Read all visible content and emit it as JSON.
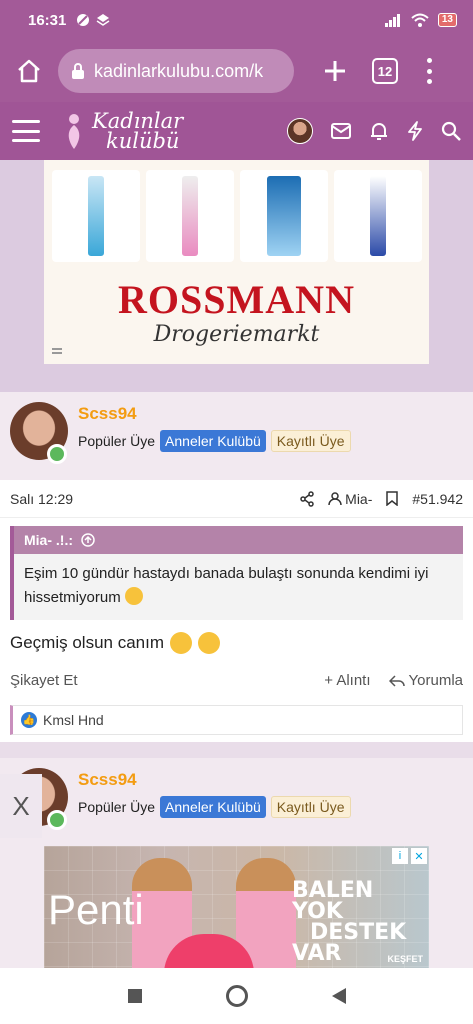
{
  "status_bar": {
    "time": "16:31",
    "battery": "13"
  },
  "browser": {
    "url": "kadinlarkulubu.com/k",
    "tab_count": "12"
  },
  "site": {
    "logo_line1": "Kadınlar",
    "logo_line2": "kulübü"
  },
  "ad_top": {
    "brand": "ROSSMANN",
    "subtitle": "Drogeriemarkt"
  },
  "post1": {
    "username": "Scss94",
    "rank": "Popüler Üye",
    "badge1": "Anneler Kulübü",
    "badge2": "Kayıtlı Üye",
    "date": "Salı 12:29",
    "quoted_user": "Mia-",
    "post_number": "#51.942",
    "quote_author": "Mia- .!.:",
    "quote_text": "Eşim 10 gündür hastaydı banada bulaştı sonunda kendimi iyi hissetmiyorum",
    "message": "Geçmiş olsun canım",
    "report": "Şikayet Et",
    "quote_action": "+ Alıntı",
    "reply_action": "Yorumla",
    "liked_by": "Kmsl Hnd"
  },
  "post2": {
    "close_label": "X",
    "username": "Scss94",
    "rank": "Popüler Üye",
    "badge1": "Anneler Kulübü",
    "badge2": "Kayıtlı Üye"
  },
  "ad_bottom": {
    "brand": "Penti",
    "headline_1": "BALEN YOK",
    "headline_2": "DESTEK",
    "headline_3": "VAR",
    "cta": "KEŞFET"
  },
  "colors": {
    "brand_purple": "#a35a98",
    "username_orange": "#f39c12",
    "badge_blue": "#3b78d6",
    "rossmann_red": "#c4141f"
  }
}
